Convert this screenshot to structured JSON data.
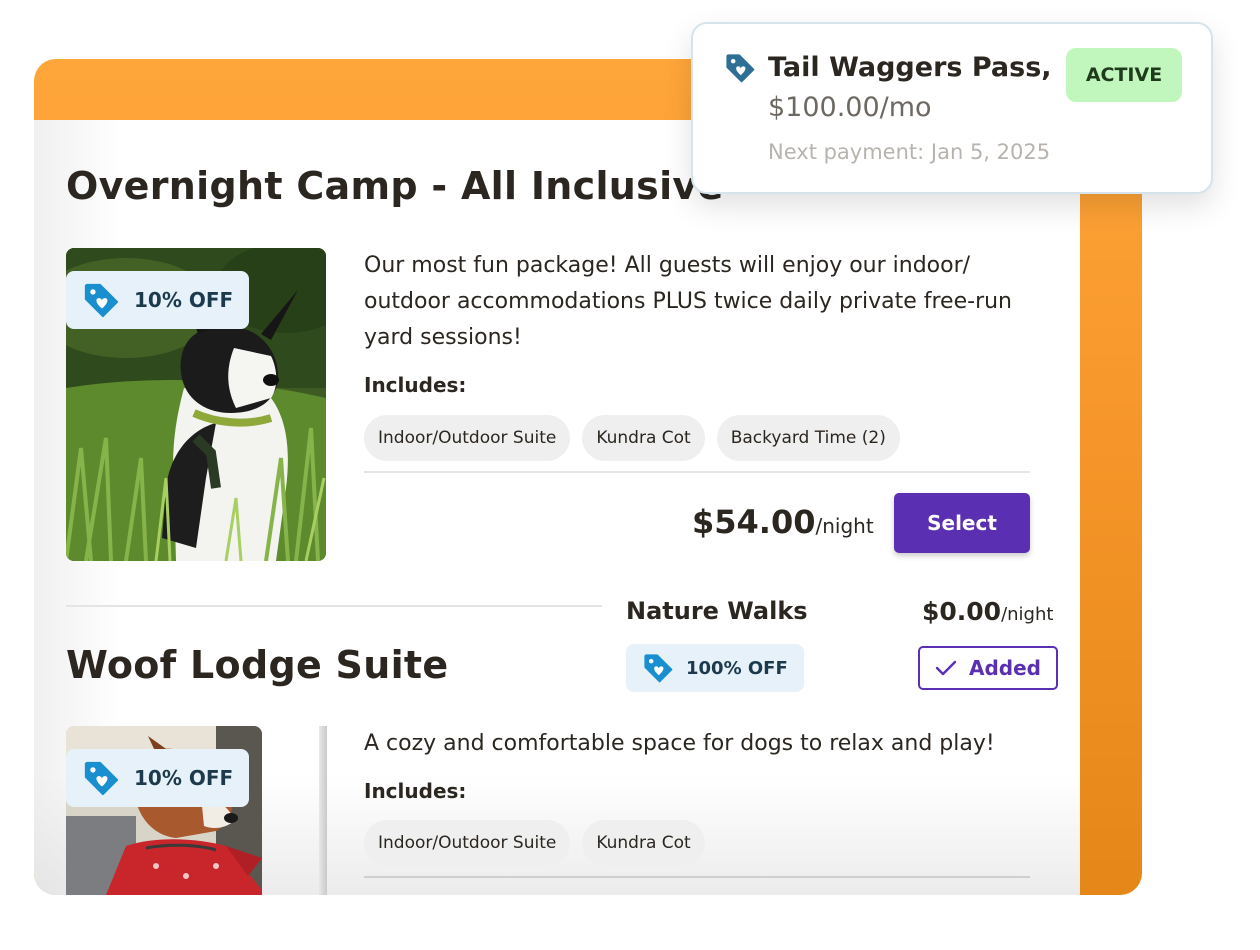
{
  "colors": {
    "accent_orange": "#ffa63a",
    "primary_purple": "#5b2fb2",
    "badge_bg": "#e6f1f9",
    "tag_icon_blue": "#1a8fd0",
    "active_green": "#c1f7bd"
  },
  "subscription": {
    "icon": "price-tag-heart-icon",
    "name": "Tail Waggers Pass,",
    "price": "$100.00/mo",
    "next_payment": "Next payment: Jan 5, 2025",
    "status": "ACTIVE"
  },
  "packages": [
    {
      "title": "Overnight Camp - All Inclusive",
      "photo": "dog-in-grass",
      "discount": "10% OFF",
      "description": "Our most fun package! All guests will enjoy our indoor/ outdoor accommodations PLUS twice daily private free-run yard sessions!",
      "includes_label": "Includes:",
      "includes": [
        "Indoor/Outdoor Suite",
        "Kundra Cot",
        "Backyard Time (2)"
      ],
      "price": "$54.00",
      "unit": "/night",
      "button": "Select"
    },
    {
      "title": "Woof Lodge Suite",
      "photo": "dog-with-red-bandana",
      "discount": "10% OFF",
      "description": "A cozy and comfortable space for dogs to relax and play!",
      "includes_label": "Includes:",
      "includes": [
        "Indoor/Outdoor Suite",
        "Kundra Cot"
      ]
    }
  ],
  "addon": {
    "title": "Nature Walks",
    "discount": "100% OFF",
    "price": "$0.00",
    "unit": "/night",
    "button": "Added",
    "button_icon": "check-icon"
  }
}
